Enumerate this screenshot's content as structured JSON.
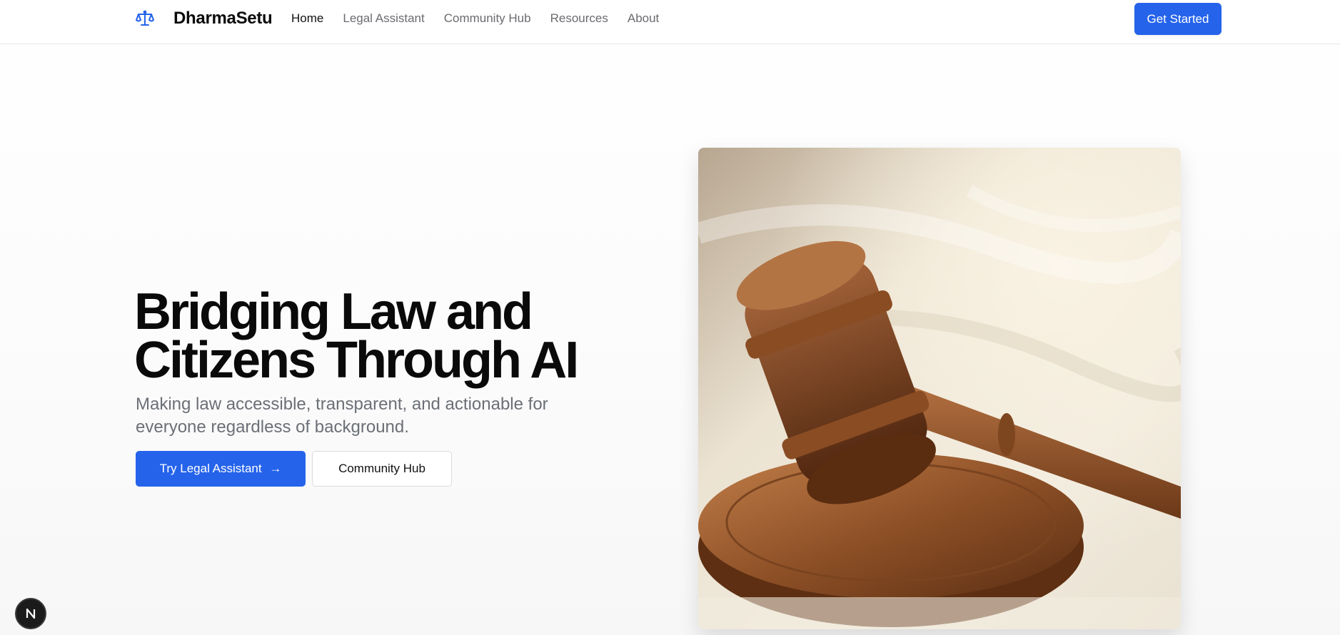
{
  "header": {
    "brand": "DharmaSetu",
    "logo_icon": "scales-of-justice-icon",
    "nav": [
      {
        "label": "Home",
        "active": true
      },
      {
        "label": "Legal Assistant",
        "active": false
      },
      {
        "label": "Community Hub",
        "active": false
      },
      {
        "label": "Resources",
        "active": false
      },
      {
        "label": "About",
        "active": false
      }
    ],
    "cta_label": "Get Started"
  },
  "hero": {
    "title_line1": "Bridging Law and",
    "title_line2": "Citizens Through AI",
    "subtitle": "Making law accessible, transparent, and actionable for everyone regardless of background.",
    "primary_button": "Try Legal Assistant",
    "primary_button_icon": "arrow-right-icon",
    "secondary_button": "Community Hub",
    "image": "judge-gavel-photo"
  },
  "badge": {
    "icon": "nextjs-logo-icon"
  },
  "colors": {
    "accent": "#2563eb",
    "text": "#0a0a0a",
    "muted": "#6b6f76"
  }
}
